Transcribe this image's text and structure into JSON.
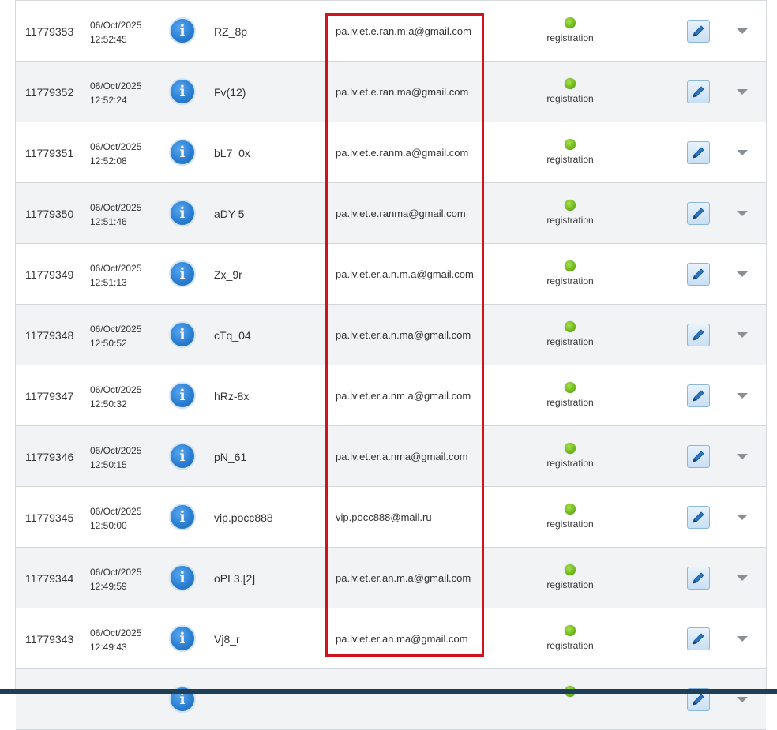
{
  "table": {
    "rows": [
      {
        "id": "11779353",
        "date": "06/Oct/2025",
        "time": "12:52:45",
        "username": "RZ_8p",
        "email": "pa.lv.et.e.ran.m.a@gmail.com",
        "status": "registration"
      },
      {
        "id": "11779352",
        "date": "06/Oct/2025",
        "time": "12:52:24",
        "username": "Fv(12)",
        "email": "pa.lv.et.e.ran.ma@gmail.com",
        "status": "registration"
      },
      {
        "id": "11779351",
        "date": "06/Oct/2025",
        "time": "12:52:08",
        "username": "bL7_0x",
        "email": "pa.lv.et.e.ranm.a@gmail.com",
        "status": "registration"
      },
      {
        "id": "11779350",
        "date": "06/Oct/2025",
        "time": "12:51:46",
        "username": "aDY-5",
        "email": "pa.lv.et.e.ranma@gmail.com",
        "status": "registration"
      },
      {
        "id": "11779349",
        "date": "06/Oct/2025",
        "time": "12:51:13",
        "username": "Zx_9r",
        "email": "pa.lv.et.er.a.n.m.a@gmail.com",
        "status": "registration"
      },
      {
        "id": "11779348",
        "date": "06/Oct/2025",
        "time": "12:50:52",
        "username": "cTq_04",
        "email": "pa.lv.et.er.a.n.ma@gmail.com",
        "status": "registration"
      },
      {
        "id": "11779347",
        "date": "06/Oct/2025",
        "time": "12:50:32",
        "username": "hRz-8x",
        "email": "pa.lv.et.er.a.nm.a@gmail.com",
        "status": "registration"
      },
      {
        "id": "11779346",
        "date": "06/Oct/2025",
        "time": "12:50:15",
        "username": "pN_61",
        "email": "pa.lv.et.er.a.nma@gmail.com",
        "status": "registration"
      },
      {
        "id": "11779345",
        "date": "06/Oct/2025",
        "time": "12:50:00",
        "username": "vip.pocc888",
        "email": "vip.pocc888@mail.ru",
        "status": "registration"
      },
      {
        "id": "11779344",
        "date": "06/Oct/2025",
        "time": "12:49:59",
        "username": "oPL3.[2]",
        "email": "pa.lv.et.er.an.m.a@gmail.com",
        "status": "registration"
      },
      {
        "id": "11779343",
        "date": "06/Oct/2025",
        "time": "12:49:43",
        "username": "Vj8_r",
        "email": "pa.lv.et.er.an.ma@gmail.com",
        "status": "registration"
      }
    ]
  },
  "icons": {
    "info": "info-icon",
    "status": "status-dot-icon",
    "edit": "pencil-icon",
    "menu": "caret-down-icon"
  },
  "colors": {
    "highlight_box": "#d0141e",
    "info_button": "#2b7fd3",
    "status_ok": "#6fb81c",
    "row_alt": "#f1f3f5",
    "bottom_bar": "#1f3f57"
  }
}
